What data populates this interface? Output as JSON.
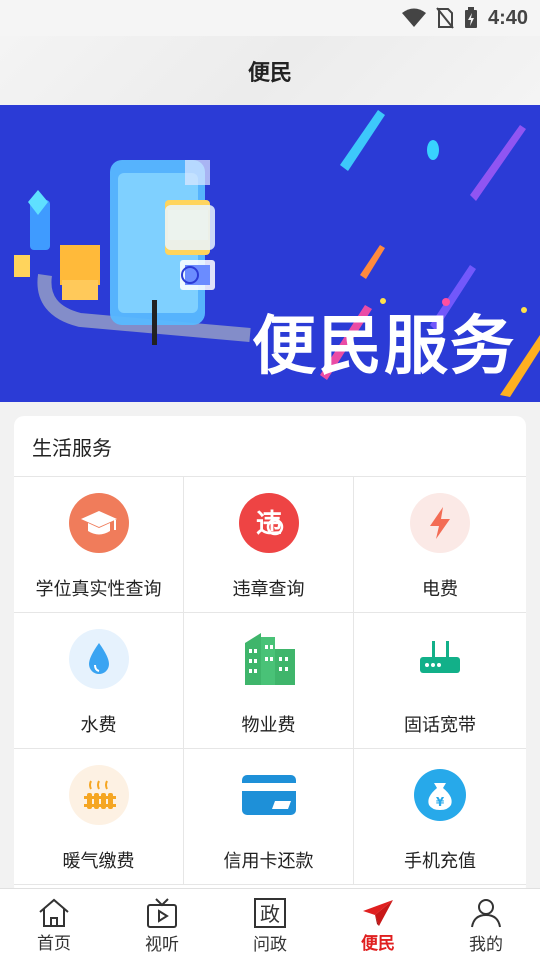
{
  "status": {
    "time": "4:40",
    "icons": [
      "wifi-icon",
      "no-sim-icon",
      "battery-charging-icon"
    ]
  },
  "header": {
    "title": "便民"
  },
  "banner": {
    "text": "便民服务",
    "dots": 2,
    "active_dot": 1
  },
  "section": {
    "title": "生活服务",
    "items": [
      {
        "label": "学位真实性查询",
        "icon": "graduation-cap-icon",
        "color": "#f07c5b"
      },
      {
        "label": "违章查询",
        "icon": "traffic-violation-icon",
        "color": "#ee4444"
      },
      {
        "label": "电费",
        "icon": "lightning-icon",
        "color": "#fbe9e6"
      },
      {
        "label": "水费",
        "icon": "water-drop-icon",
        "color": "#e6f2fd"
      },
      {
        "label": "物业费",
        "icon": "buildings-icon",
        "color": "#3fb56b"
      },
      {
        "label": "固话宽带",
        "icon": "router-icon",
        "color": "#12b089"
      },
      {
        "label": "暖气缴费",
        "icon": "radiator-icon",
        "color": "#fdf1e3"
      },
      {
        "label": "信用卡还款",
        "icon": "credit-card-icon",
        "color": "#1e90d8"
      },
      {
        "label": "手机充值",
        "icon": "money-bag-icon",
        "color": "#27a9ea"
      }
    ]
  },
  "tabs": [
    {
      "label": "首页",
      "icon": "home-icon"
    },
    {
      "label": "视听",
      "icon": "tv-icon"
    },
    {
      "label": "问政",
      "icon": "zheng-icon",
      "glyph": "政"
    },
    {
      "label": "便民",
      "icon": "paper-plane-icon",
      "active": true
    },
    {
      "label": "我的",
      "icon": "person-icon"
    }
  ],
  "colors": {
    "accent": "#e02020",
    "banner_bg": "#2b3bd6"
  }
}
